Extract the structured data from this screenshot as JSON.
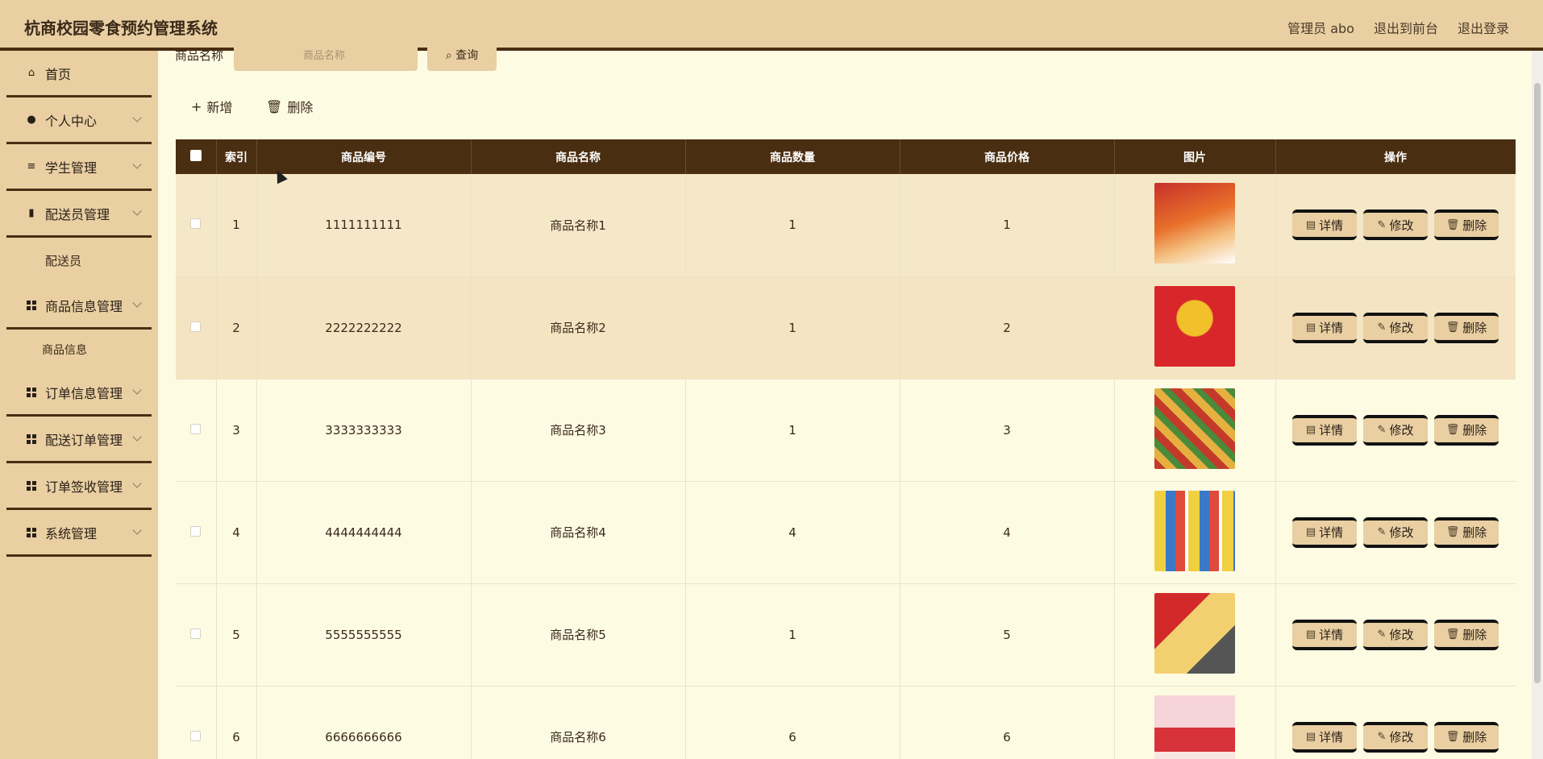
{
  "header": {
    "title": "杭商校园零食预约管理系统",
    "admin": "管理员 abo",
    "to_front": "退出到前台",
    "logout": "退出登录"
  },
  "sidebar": {
    "items": [
      {
        "label": "首页",
        "icon": "home-icon"
      },
      {
        "label": "个人中心",
        "icon": "user-icon"
      },
      {
        "label": "学生管理",
        "icon": "list-icon"
      },
      {
        "label": "配送员管理",
        "icon": "book-icon"
      },
      {
        "label": "配送员",
        "type": "sub"
      },
      {
        "label": "商品信息管理",
        "icon": "grid-icon"
      },
      {
        "label": "商品信息",
        "type": "sub"
      },
      {
        "label": "订单信息管理",
        "icon": "grid-icon"
      },
      {
        "label": "配送订单管理",
        "icon": "grid-icon"
      },
      {
        "label": "订单签收管理",
        "icon": "grid-icon"
      },
      {
        "label": "系统管理",
        "icon": "grid-icon"
      }
    ]
  },
  "search": {
    "label": "商品名称",
    "placeholder": "商品名称",
    "button": "查询"
  },
  "actions": {
    "add": "新增",
    "delete": "删除"
  },
  "table": {
    "headers": [
      "索引",
      "商品编号",
      "商品名称",
      "商品数量",
      "商品价格",
      "图片",
      "操作"
    ],
    "rows": [
      {
        "index": "1",
        "code": "1111111111",
        "name": "商品名称1",
        "qty": "1",
        "price": "1"
      },
      {
        "index": "2",
        "code": "2222222222",
        "name": "商品名称2",
        "qty": "1",
        "price": "2"
      },
      {
        "index": "3",
        "code": "3333333333",
        "name": "商品名称3",
        "qty": "1",
        "price": "3"
      },
      {
        "index": "4",
        "code": "4444444444",
        "name": "商品名称4",
        "qty": "4",
        "price": "4"
      },
      {
        "index": "5",
        "code": "5555555555",
        "name": "商品名称5",
        "qty": "1",
        "price": "5"
      },
      {
        "index": "6",
        "code": "6666666666",
        "name": "商品名称6",
        "qty": "6",
        "price": "6"
      }
    ],
    "op_labels": {
      "detail": "详情",
      "edit": "修改",
      "delete": "删除"
    }
  },
  "colors": {
    "header_bg": "#e9cfa2",
    "accent_dark": "#4a2e12",
    "page_bg": "#fefbe3"
  }
}
